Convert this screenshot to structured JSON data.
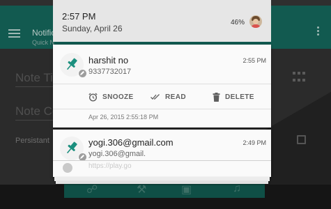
{
  "background_app": {
    "title": "Notific",
    "subtitle": "Quick N",
    "field_title_placeholder": "Note Ti",
    "field_content_placeholder": "Note Co",
    "persistent_label": "Persistant",
    "accent_color": "#125a50"
  },
  "shade": {
    "time": "2:57 PM",
    "date": "Sunday, April 26",
    "battery": "46%"
  },
  "notifications": [
    {
      "title": "harshit no",
      "text": "9337732017",
      "time": "2:55 PM",
      "icon": "pushpin-icon",
      "actions": [
        {
          "label": "SNOOZE",
          "icon": "alarm-clock-icon"
        },
        {
          "label": "READ",
          "icon": "double-check-icon"
        },
        {
          "label": "DELETE",
          "icon": "trash-icon"
        }
      ],
      "timestamp": "Apr 26, 2015 2:55:18 PM"
    },
    {
      "title": "yogi.306@gmail.com",
      "text": "yogi.306@gmail.",
      "time": "2:49 PM",
      "icon": "pushpin-icon",
      "peek_text": "https://play.go"
    }
  ]
}
